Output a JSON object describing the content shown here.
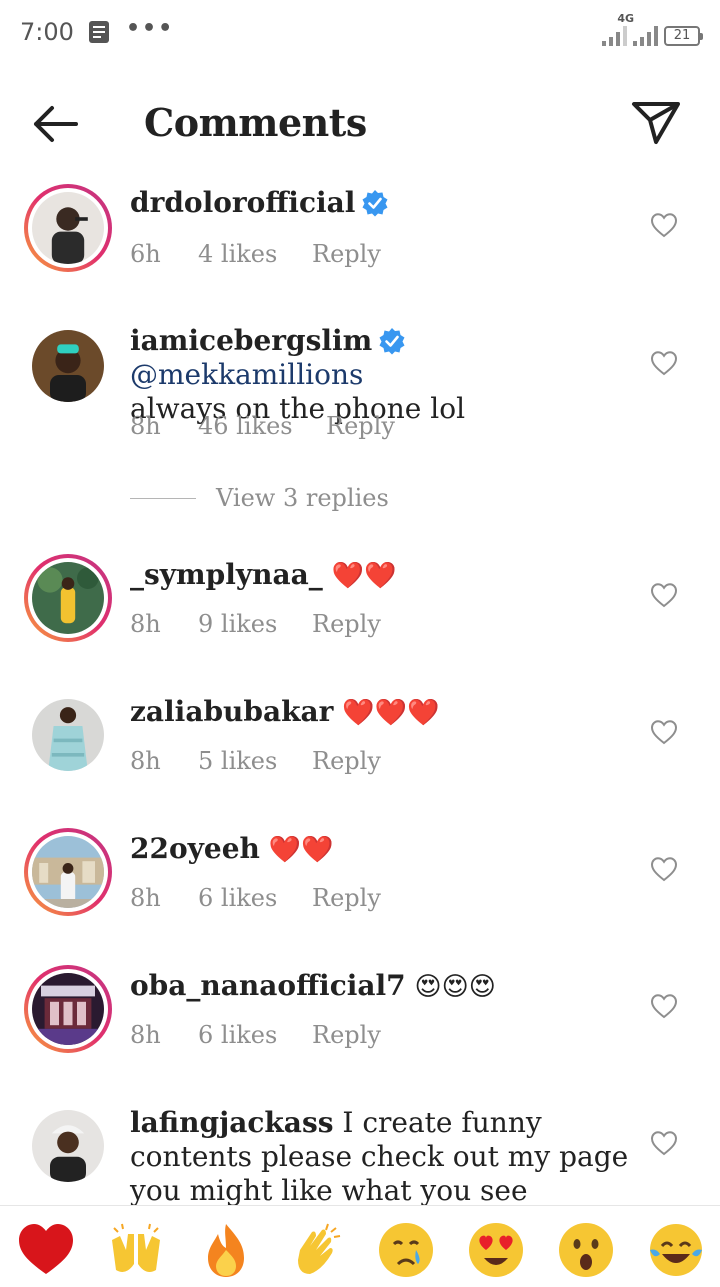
{
  "status_bar": {
    "time": "7:00",
    "network": "4G",
    "battery": "21",
    "icons": [
      "document-icon",
      "more-dots-icon",
      "signal-icon",
      "battery-icon"
    ]
  },
  "header": {
    "title": "Comments",
    "back_icon": "arrow-left-icon",
    "send_icon": "paper-plane-icon"
  },
  "comments": [
    {
      "username": "drdolorofficial",
      "verified": true,
      "text": "",
      "time": "6h",
      "likes": "4 likes",
      "reply": "Reply"
    },
    {
      "username": "iamicebergslim",
      "verified": true,
      "mention": "@mekkamillions",
      "text": "always on the phone lol",
      "time": "8h",
      "likes": "46 likes",
      "reply": "Reply",
      "view_replies": "View 3 replies"
    },
    {
      "username": "_symplynaa_",
      "verified": false,
      "text": "❤️❤️",
      "time": "8h",
      "likes": "9 likes",
      "reply": "Reply"
    },
    {
      "username": "zaliabubakar",
      "verified": false,
      "text": "❤️❤️❤️",
      "time": "8h",
      "likes": "5 likes",
      "reply": "Reply"
    },
    {
      "username": "22oyeeh",
      "verified": false,
      "text": "❤️❤️",
      "time": "8h",
      "likes": "6 likes",
      "reply": "Reply"
    },
    {
      "username": "oba_nanaofficial7",
      "verified": false,
      "text": "😍😍😍",
      "time": "8h",
      "likes": "6 likes",
      "reply": "Reply"
    },
    {
      "username": "lafingjackass",
      "verified": false,
      "text": "I create funny contents please check out my page you might like what you see"
    }
  ],
  "quick_reactions": [
    "❤️",
    "🙌",
    "🔥",
    "👏",
    "😢",
    "😍",
    "😮",
    "😂"
  ],
  "colors": {
    "ring_gradient_start": "#f9a33b",
    "ring_gradient_end": "#c13584",
    "verified_blue": "#3897f0",
    "mention": "#1c3a6b",
    "meta_gray": "#8e8e8e",
    "heart_red": "#d0151b"
  }
}
